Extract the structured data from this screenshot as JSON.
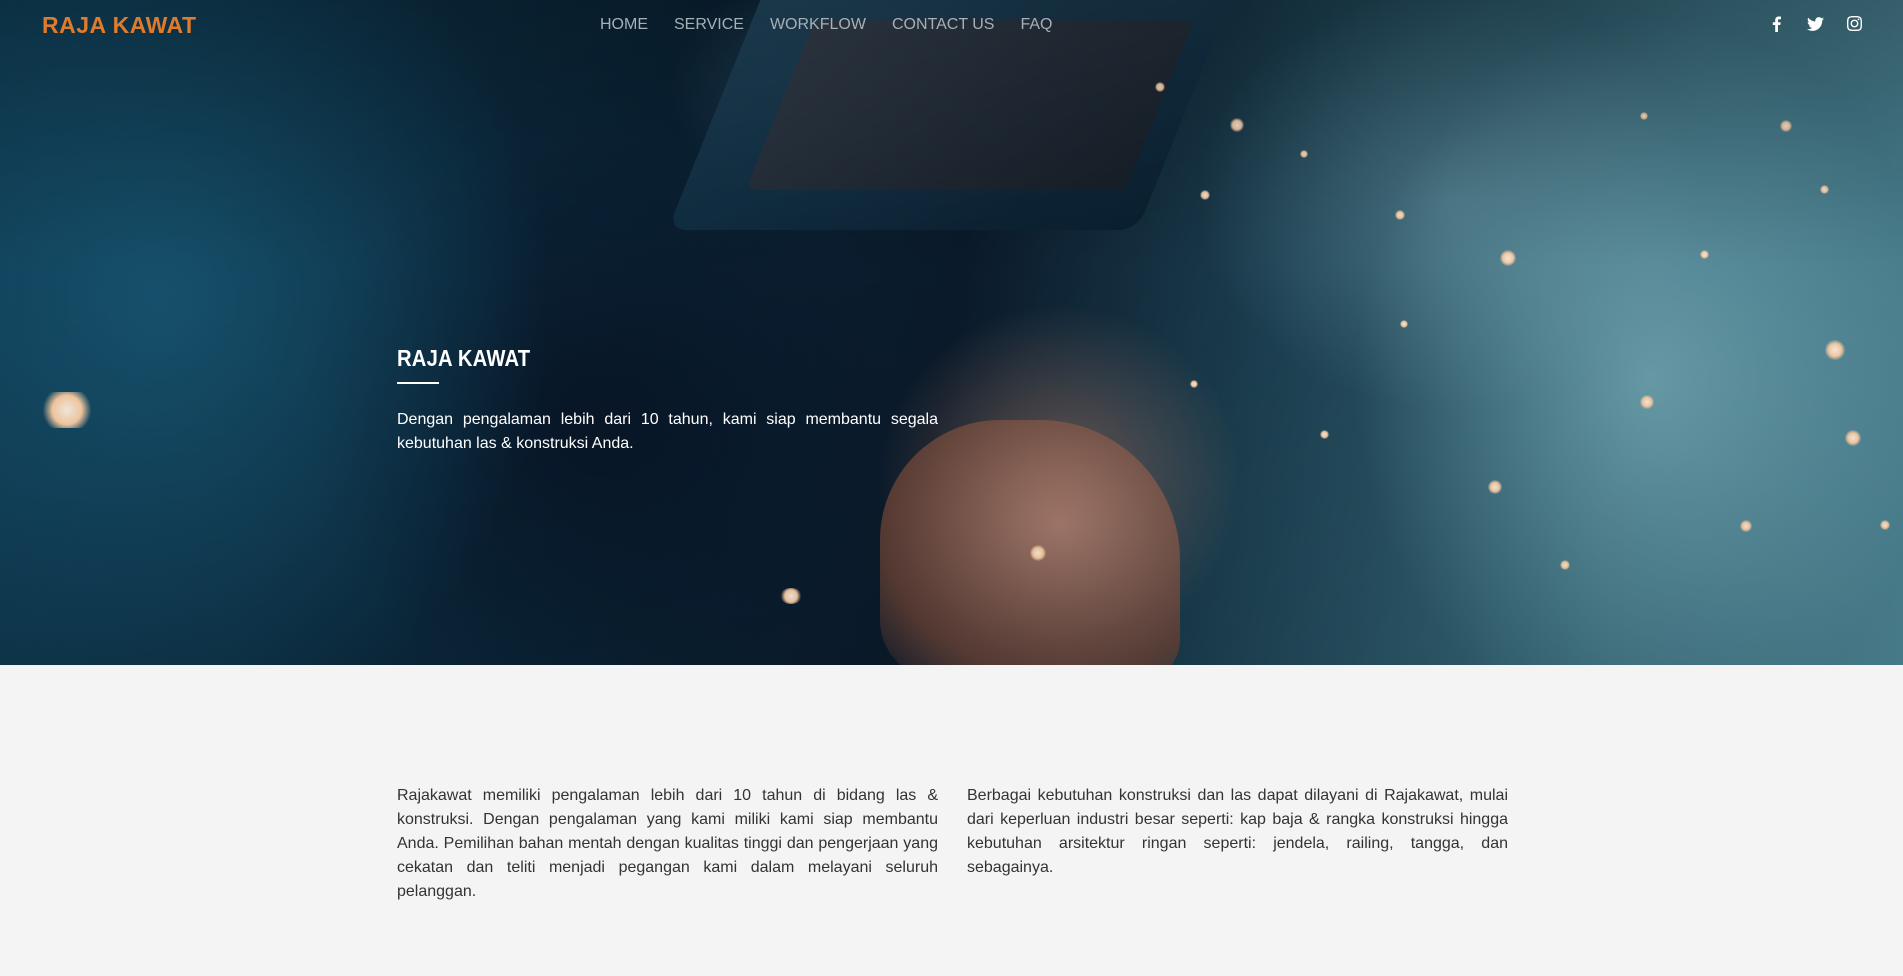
{
  "brand": {
    "name": "RAJA KAWAT",
    "color": "#e07b2b"
  },
  "nav": {
    "items": [
      {
        "label": "HOME"
      },
      {
        "label": "SERVICE"
      },
      {
        "label": "WORKFLOW"
      },
      {
        "label": "CONTACT US"
      },
      {
        "label": "FAQ"
      }
    ]
  },
  "socials": [
    {
      "icon": "facebook-icon"
    },
    {
      "icon": "twitter-icon"
    },
    {
      "icon": "instagram-icon"
    }
  ],
  "hero": {
    "title": "RAJA KAWAT",
    "description": "Dengan pengalaman lebih dari 10 tahun, kami siap membantu segala kebutuhan las & konstruksi Anda."
  },
  "about": {
    "left": "Rajakawat memiliki pengalaman lebih dari 10 tahun di bidang las & konstruksi. Dengan pengalaman yang kami miliki kami siap membantu Anda. Pemilihan bahan mentah dengan kualitas tinggi dan pengerjaan yang cekatan dan teliti menjadi pegangan kami dalam melayani seluruh pelanggan.",
    "right": "Berbagai kebutuhan konstruksi dan las dapat dilayani di Rajakawat, mulai dari keperluan industri besar seperti: kap baja & rangka konstruksi hingga kebutuhan arsitektur ringan seperti: jendela, railing, tangga, dan sebagainya."
  }
}
